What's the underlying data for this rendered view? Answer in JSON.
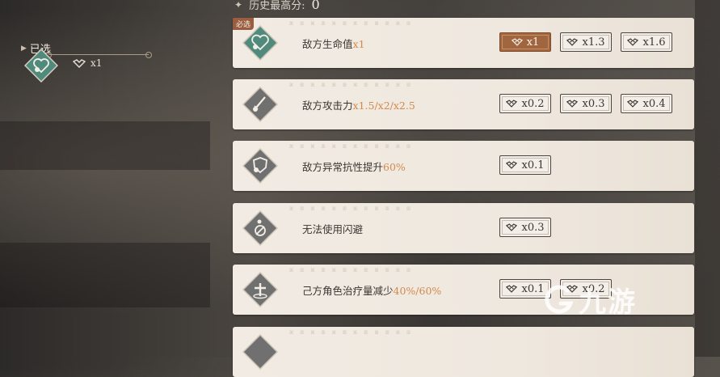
{
  "header": {
    "icon": "star-icon",
    "label": "历史最高分:",
    "value": "0"
  },
  "selected": {
    "label": "已选",
    "icon": "heart-emblem-icon",
    "multiplier": "x1",
    "accent": "#4f8a7d"
  },
  "cards": [
    {
      "must": "必选",
      "icon": "heart-emblem-icon",
      "icon_color": "#4f8a7d",
      "label_text": "敌方生命值",
      "label_highlight": "x1",
      "buttons": [
        "x1",
        "x1.3",
        "x1.6"
      ],
      "active_index": 0
    },
    {
      "must": "",
      "icon": "sword-icon",
      "icon_color": "#707070",
      "label_text": "敌方攻击力",
      "label_highlight": "x1.5/x2/x2.5",
      "buttons": [
        "x0.2",
        "x0.3",
        "x0.4"
      ],
      "active_index": -1
    },
    {
      "must": "",
      "icon": "shield-icon",
      "icon_color": "#707070",
      "label_text": "敌方异常抗性提升",
      "label_highlight": "60%",
      "buttons": [
        "x0.1"
      ],
      "active_index": -1
    },
    {
      "must": "",
      "icon": "no-dodge-icon",
      "icon_color": "#707070",
      "label_text": "无法使用闪避",
      "label_highlight": "",
      "buttons": [
        "x0.3"
      ],
      "active_index": -1
    },
    {
      "must": "",
      "icon": "heal-cross-icon",
      "icon_color": "#707070",
      "label_text": "己方角色治疗量减少",
      "label_highlight": "40%/60%",
      "buttons": [
        "x0.1",
        "x0.2"
      ],
      "active_index": -1
    },
    {
      "must": "",
      "icon": "emblem-icon",
      "icon_color": "#707070",
      "label_text": "",
      "label_highlight": "",
      "buttons": [],
      "active_index": -1
    }
  ],
  "colors": {
    "highlight": "#d28a4d",
    "active_button": "#a0663f",
    "card_bg": "#f1ebe3"
  },
  "watermark": {
    "text": "九游",
    "icon": "g-logo-icon"
  }
}
